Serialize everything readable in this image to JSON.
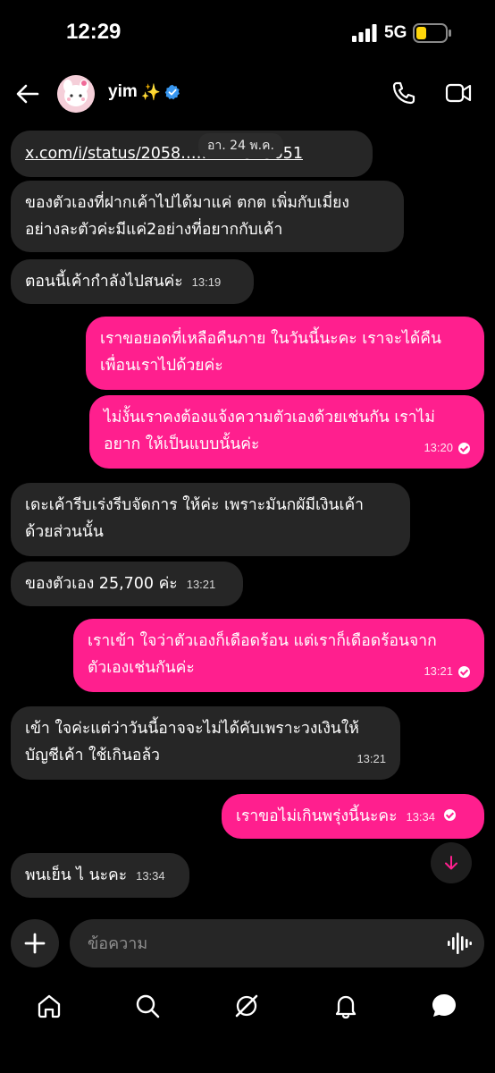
{
  "status": {
    "time": "12:29",
    "network": "5G"
  },
  "header": {
    "name": "yim",
    "name_emoji": "✨"
  },
  "date_chip": "อา. 24 พ.ค.",
  "messages": [
    {
      "id": "m0",
      "dir": "in",
      "type": "link",
      "text": "x.com/i/status/2058…………545651"
    },
    {
      "id": "m1",
      "dir": "in",
      "lines": [
        "ของตัวเองที่ฝากเค้าไปได้มาแค่ ตกต เพิ่มกับเมี่ยง",
        "อย่างละตัวค่ะมีแค่2อย่างที่อยากกับเค้า"
      ]
    },
    {
      "id": "m2",
      "dir": "in",
      "text": "ตอนนี้เค้ากำลังไปสนค่ะ",
      "time": "13:19"
    },
    {
      "id": "m3",
      "dir": "out",
      "lines": [
        "เราขอยอดที่เหลือคืนภาย ในวันนี้นะคะ เราจะได้คืน",
        "เพื่อนเราไปด้วยค่ะ"
      ]
    },
    {
      "id": "m4",
      "dir": "out",
      "lines": [
        "ไม่งั้นเราคงต้องแจ้งความตัวเองด้วยเช่นกัน เราไม่",
        "อยาก ให้เป็นแบบนั้นค่ะ"
      ],
      "time": "13:20"
    },
    {
      "id": "m5",
      "dir": "in",
      "lines": [
        "เดะเค้ารีบเร่งรีบจัดการ ให้ค่ะ เพราะมันกผัมีเงินเค้า",
        "ด้วยส่วนนั้น"
      ]
    },
    {
      "id": "m6",
      "dir": "in",
      "text": "ของตัวเอง 25,700 ค่ะ",
      "time": "13:21"
    },
    {
      "id": "m7",
      "dir": "out",
      "lines": [
        "เราเข้า ใจว่าตัวเองก็เดือดร้อน แต่เราก็เดือดร้อนจาก",
        "ตัวเองเช่นกันค่ะ"
      ],
      "time": "13:21"
    },
    {
      "id": "m8",
      "dir": "in",
      "lines": [
        "เข้า ใจค่ะแต่ว่าวันนี้อาจจะไม่ได้คับเพราะวงเงินให้",
        "บัญชีเค้า ใช้เกินอล้ว"
      ],
      "time": "13:21"
    },
    {
      "id": "m9",
      "dir": "out",
      "text": "เราขอไม่เกินพรุ่งนี้นะคะ",
      "time": "13:34"
    },
    {
      "id": "m10",
      "dir": "in",
      "text": "พนเย็น ไ นะคะ",
      "time": "13:34"
    }
  ],
  "composer": {
    "placeholder": "ข้อความ"
  },
  "colors": {
    "outgoing": "#ff1f8e",
    "incoming": "#262626",
    "verified": "#3897f0",
    "battery": "#ffd60a"
  }
}
